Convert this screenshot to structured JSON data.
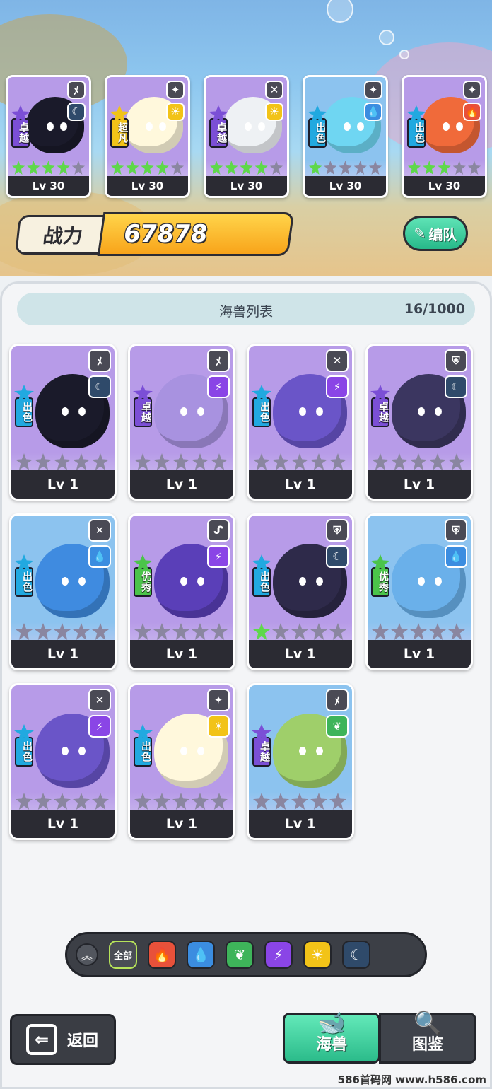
{
  "colors": {
    "purple_bg": "#b79be8",
    "blue_bg": "#8cc3ef",
    "rank_excellent": "#7b4fd6",
    "rank_good": "#21a9e0",
    "rank_normal": "#4bc44a",
    "rank_super": "#f2c318",
    "star_on": "#5ed84a",
    "star_off": "#8a86a0",
    "fire": "#e8513a",
    "water": "#3b8de0",
    "grass": "#3eb45a",
    "thunder": "#8a45e6",
    "light": "#f2c318",
    "dark": "#2f4a6a"
  },
  "team": [
    {
      "rank": "卓越",
      "rank_color": "#7b4fd6",
      "class_icon": "sword-icon",
      "class_glyph": "ﾒ",
      "element": "dark",
      "element_glyph": "☾",
      "element_color": "#2f4a6a",
      "stars": 4,
      "level": "Lv 30",
      "creature": "black-octopus",
      "body": "#1a1a2a"
    },
    {
      "rank": "超凡",
      "rank_color": "#f2c318",
      "class_icon": "wings-icon",
      "class_glyph": "✦",
      "element": "light",
      "element_glyph": "☀",
      "element_color": "#f2c318",
      "stars": 4,
      "level": "Lv 30",
      "creature": "white-fluff",
      "body": "#fff8dc"
    },
    {
      "rank": "卓越",
      "rank_color": "#7b4fd6",
      "class_icon": "bow-icon",
      "class_glyph": "✕",
      "element": "light",
      "element_glyph": "☀",
      "element_color": "#f2c318",
      "stars": 4,
      "level": "Lv 30",
      "creature": "white-fish",
      "body": "#eef1f4"
    },
    {
      "rank": "出色",
      "rank_color": "#21a9e0",
      "class_icon": "wings-icon",
      "class_glyph": "✦",
      "element": "water",
      "element_glyph": "💧",
      "element_color": "#3b8de0",
      "stars": 1,
      "level": "Lv 30",
      "creature": "blue-starfish",
      "body": "#6fd6f2"
    },
    {
      "rank": "出色",
      "rank_color": "#21a9e0",
      "class_icon": "wings-icon",
      "class_glyph": "✦",
      "element": "fire",
      "element_glyph": "🔥",
      "element_color": "#e8513a",
      "stars": 3,
      "level": "Lv 30",
      "creature": "fire-jelly",
      "body": "#f06a3a"
    }
  ],
  "power": {
    "label": "战力",
    "value": "67878"
  },
  "edit_button": {
    "label": "编队"
  },
  "list": {
    "title": "海兽列表",
    "count": "16/1000"
  },
  "monsters": [
    {
      "rank": "出色",
      "rank_color": "#21a9e0",
      "class_icon": "sword-icon",
      "class_glyph": "ﾒ",
      "element": "dark",
      "element_glyph": "☾",
      "element_color": "#2f4a6a",
      "stars": 0,
      "level": "Lv 1",
      "creature": "black-octopus",
      "body": "#1a1a2a",
      "bg": "#b79be8"
    },
    {
      "rank": "卓越",
      "rank_color": "#7b4fd6",
      "class_icon": "sword-icon",
      "class_glyph": "ﾒ",
      "element": "thunder",
      "element_glyph": "⚡",
      "element_color": "#8a45e6",
      "stars": 0,
      "level": "Lv 1",
      "creature": "purple-squid",
      "body": "#a892e0",
      "bg": "#b79be8"
    },
    {
      "rank": "出色",
      "rank_color": "#21a9e0",
      "class_icon": "bow-icon",
      "class_glyph": "✕",
      "element": "thunder",
      "element_glyph": "⚡",
      "element_color": "#8a45e6",
      "stars": 0,
      "level": "Lv 1",
      "creature": "purple-flyfish",
      "body": "#6a55c8",
      "bg": "#b79be8"
    },
    {
      "rank": "卓越",
      "rank_color": "#7b4fd6",
      "class_icon": "shield-icon",
      "class_glyph": "⛨",
      "element": "dark",
      "element_glyph": "☾",
      "element_color": "#2f4a6a",
      "stars": 0,
      "level": "Lv 1",
      "creature": "spiky-urchin",
      "body": "#3b3660",
      "bg": "#b79be8"
    },
    {
      "rank": "出色",
      "rank_color": "#21a9e0",
      "class_icon": "bow-icon",
      "class_glyph": "✕",
      "element": "water",
      "element_glyph": "💧",
      "element_color": "#3b8de0",
      "stars": 0,
      "level": "Lv 1",
      "creature": "blue-seahorse",
      "body": "#3f8be0",
      "bg": "#8cc3ef"
    },
    {
      "rank": "优秀",
      "rank_color": "#4bc44a",
      "class_icon": "staff-icon",
      "class_glyph": "ᔑ",
      "element": "thunder",
      "element_glyph": "⚡",
      "element_color": "#8a45e6",
      "stars": 0,
      "level": "Lv 1",
      "creature": "purple-eel",
      "body": "#5a3fb8",
      "bg": "#b79be8"
    },
    {
      "rank": "出色",
      "rank_color": "#21a9e0",
      "class_icon": "shield-icon",
      "class_glyph": "⛨",
      "element": "dark",
      "element_glyph": "☾",
      "element_color": "#2f4a6a",
      "stars": 1,
      "level": "Lv 1",
      "creature": "dark-urchin",
      "body": "#2e2a4a",
      "bg": "#b79be8"
    },
    {
      "rank": "优秀",
      "rank_color": "#4bc44a",
      "class_icon": "shield-icon",
      "class_glyph": "⛨",
      "element": "water",
      "element_glyph": "💧",
      "element_color": "#3b8de0",
      "stars": 0,
      "level": "Lv 1",
      "creature": "hermit-crab",
      "body": "#6ab0ea",
      "bg": "#8cc3ef"
    },
    {
      "rank": "出色",
      "rank_color": "#21a9e0",
      "class_icon": "bow-icon",
      "class_glyph": "✕",
      "element": "thunder",
      "element_glyph": "⚡",
      "element_color": "#8a45e6",
      "stars": 0,
      "level": "Lv 1",
      "creature": "purple-flyfish",
      "body": "#6a55c8",
      "bg": "#b79be8"
    },
    {
      "rank": "出色",
      "rank_color": "#21a9e0",
      "class_icon": "wings-icon",
      "class_glyph": "✦",
      "element": "light",
      "element_glyph": "☀",
      "element_color": "#f2c318",
      "stars": 0,
      "level": "Lv 1",
      "creature": "white-fluff",
      "body": "#fff8dc",
      "bg": "#b79be8"
    },
    {
      "rank": "卓越",
      "rank_color": "#7b4fd6",
      "class_icon": "sword-icon",
      "class_glyph": "ﾒ",
      "element": "grass",
      "element_glyph": "❦",
      "element_color": "#3eb45a",
      "stars": 0,
      "level": "Lv 1",
      "creature": "green-leaf",
      "body": "#9fcf6a",
      "bg": "#8cc3ef"
    }
  ],
  "filter": {
    "toggle_icon": "collapse-chevrons-icon",
    "toggle_glyph": "︽",
    "all_label": "全部",
    "elements": [
      {
        "name": "fire-filter-icon",
        "glyph": "🔥",
        "color": "#e8513a"
      },
      {
        "name": "water-filter-icon",
        "glyph": "💧",
        "color": "#3b8de0"
      },
      {
        "name": "grass-filter-icon",
        "glyph": "❦",
        "color": "#3eb45a"
      },
      {
        "name": "thunder-filter-icon",
        "glyph": "⚡",
        "color": "#8a45e6"
      },
      {
        "name": "light-filter-icon",
        "glyph": "☀",
        "color": "#f2c318"
      },
      {
        "name": "dark-filter-icon",
        "glyph": "☾",
        "color": "#2f4a6a"
      }
    ]
  },
  "back_button": {
    "label": "返回",
    "icon_glyph": "⇐"
  },
  "tabs": [
    {
      "label": "海兽",
      "icon": "whale-icon",
      "glyph": "🐋",
      "active": true
    },
    {
      "label": "图鉴",
      "icon": "book-magnifier-icon",
      "glyph": "🔍",
      "active": false
    }
  ],
  "watermark": "586首码网 www.h586.com"
}
